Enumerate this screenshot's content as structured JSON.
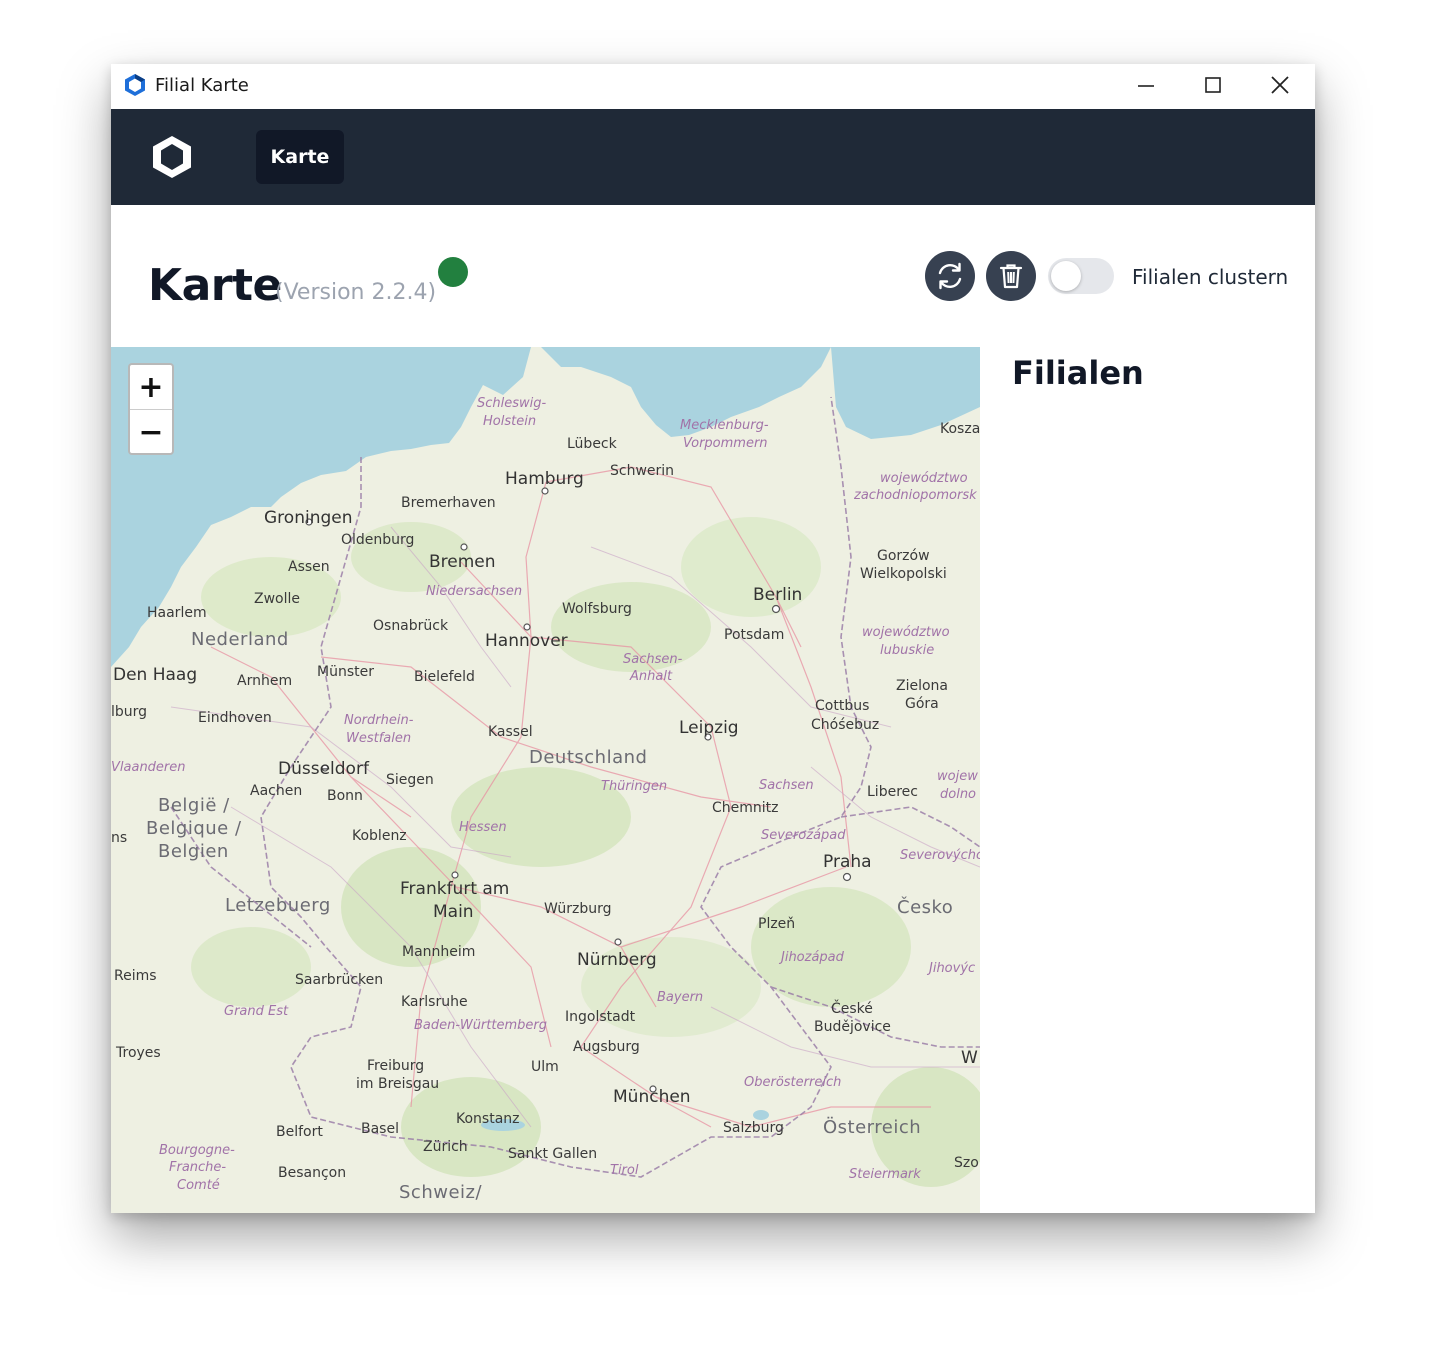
{
  "window": {
    "title": "Filial Karte",
    "controls": [
      "minimize",
      "maximize",
      "close"
    ]
  },
  "navbar": {
    "logo_icon": "hexagon-logo-icon",
    "tabs": [
      {
        "label": "Karte",
        "active": true
      }
    ]
  },
  "header": {
    "title": "Karte",
    "version": "(Version 2.2.4)",
    "status_color": "#22803f",
    "refresh_icon": "refresh-icon",
    "trash_icon": "trash-icon",
    "cluster_toggle": {
      "label": "Filialen clustern",
      "on": false
    }
  },
  "map": {
    "zoom_in": "+",
    "zoom_out": "−",
    "labels": {
      "countries": [
        "Deutschland",
        "Nederland",
        "België /",
        "Belgique /",
        "Belgien",
        "Letzebuerg",
        "Česko",
        "Österreich",
        "Schweiz/"
      ],
      "regions": [
        "Schleswig-",
        "Holstein",
        "Mecklenburg-",
        "Vorpommern",
        "Niedersachsen",
        "Sachsen-",
        "Anhalt",
        "Nordrhein-",
        "Westfalen",
        "Vlaanderen",
        "Thüringen",
        "Sachsen",
        "Hessen",
        "Severozápad",
        "Severovýchc",
        "Jihozápad",
        "Jihovýc",
        "Bayern",
        "Baden-Württemberg",
        "Grand Est",
        "Bourgogne-",
        "Franche-",
        "Comté",
        "Oberösterreich",
        "Tirol",
        "Steiermark",
        "województwo",
        "zachodniopomorsk",
        "województwo",
        "lubuskie",
        "wojew",
        "dolno"
      ],
      "big_cities": [
        "Hamburg",
        "Bremen",
        "Hannover",
        "Berlin",
        "Leipzig",
        "Düsseldorf",
        "Frankfurt am",
        "Main",
        "Nürnberg",
        "München",
        "Praha",
        "Groningen",
        "Den Haag"
      ],
      "cities": [
        "Lübeck",
        "Schwerin",
        "Bremerhaven",
        "Oldenburg",
        "Assen",
        "Zwolle",
        "Haarlem",
        "Arnhem",
        "Eindhoven",
        "lburg",
        "Osnabrück",
        "Münster",
        "Bielefeld",
        "Wolfsburg",
        "Potsdam",
        "Kassel",
        "Aachen",
        "Bonn",
        "Siegen",
        "Koblenz",
        "Chemnitz",
        "Cottbus",
        "Chóśebuz",
        "Liberec",
        "Gorzów",
        "Wielkopolski",
        "Zielona",
        "Góra",
        "Kosza",
        "Würzburg",
        "Plzeň",
        "Mannheim",
        "Saarbrücken",
        "Karlsruhe",
        "Ingolstadt",
        "Augsburg",
        "Ulm",
        "České",
        "Budějovice",
        "Reims",
        "Troyes",
        "Freiburg",
        "im Breisgau",
        "Konstanz",
        "Basel",
        "Zürich",
        "Sankt Gallen",
        "Salzburg",
        "Belfort",
        "Besançon",
        "W",
        "Szo",
        "ns"
      ]
    }
  },
  "panel": {
    "title": "Filialen"
  }
}
